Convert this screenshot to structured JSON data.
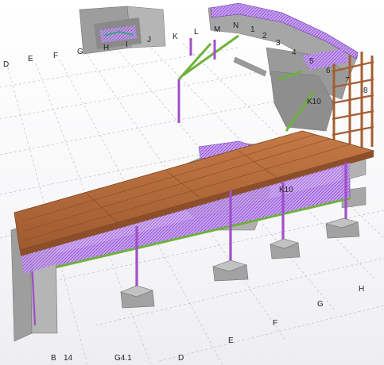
{
  "grid_labels": {
    "D_top": "D",
    "E_top": "E",
    "F_top": "F",
    "G_top": "G",
    "H_top": "H",
    "I_top": "I",
    "J_top": "J",
    "K_top": "K",
    "L_top": "L",
    "M_top": "M",
    "N_top": "N",
    "n1": "1",
    "n2": "2",
    "n3": "3",
    "n4": "4",
    "n5": "5",
    "n6": "6",
    "n7": "7",
    "n8": "8",
    "K10_upper": "K10",
    "K10_lower": "K10",
    "H_right": "H",
    "G_right": "G",
    "F_right": "F",
    "E_right": "E",
    "B_bottom": "B",
    "n14_bottom": "14",
    "G41_bottom": "G4.1",
    "D_bottom": "D"
  },
  "colors": {
    "deck_timber": "#b46a3c",
    "steel_column": "#a050c8",
    "mesh_railing": "#b070e0",
    "stringer_green": "#6fb23a",
    "concrete_grey": "#9b9b9b"
  }
}
